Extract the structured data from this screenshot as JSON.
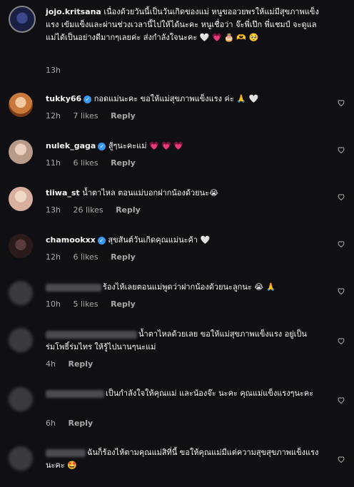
{
  "comments": [
    {
      "user": "jojo.kritsana",
      "verified": false,
      "text": "เนื่องด้วยวันนี้เป็นวันเกิดของแม่ หนูขออวยพรให้แม่มีสุขภาพแข็งแรง เข้มแข็งและผ่านช่วงเวลานี้ไปให้ได้นะคะ หนูเชื่อว่า จ๊ะพี่เป๊ก พี่แชมป์ จะดูแลแม่ได้เป็นอย่างดีมากๆเลยค่ะ ส่งกำลังใจนะคะ 🤍 💗 🎂 🫶 🥺",
      "time": "13h",
      "likes": "",
      "reply": ""
    },
    {
      "user": "tukky66",
      "verified": true,
      "text": "กอดแม่นะคะ ขอให้แม่สุขภาพแข็งแรง ค่ะ 🙏 🤍",
      "time": "12h",
      "likes": "7 likes",
      "reply": "Reply"
    },
    {
      "user": "nulek_gaga",
      "verified": true,
      "text": "สู้ๆนะคะแม่ 💗 💗 💗",
      "time": "11h",
      "likes": "6 likes",
      "reply": "Reply"
    },
    {
      "user": "tiiwa_st",
      "verified": false,
      "text": "น้ำตาไหล ตอนแม่บอกฝากน้องด้วยนะ😭",
      "time": "13h",
      "likes": "26 likes",
      "reply": "Reply"
    },
    {
      "user": "chamookxx",
      "verified": true,
      "text": "สุขสันต์วันเกิดคุณแม่นะค้า 🤍",
      "time": "12h",
      "likes": "6 likes",
      "reply": "Reply"
    },
    {
      "user": "",
      "verified": false,
      "text": "ร้องไห้เลยตอนแม่พูดว่าฝากน้องด้วยนะลูกนะ 😭 🙏",
      "time": "10h",
      "likes": "5 likes",
      "reply": "Reply"
    },
    {
      "user": "",
      "verified": false,
      "text": "น้ำตาไหลด้วยเลย ขอให้แม่สุขภาพแข็งแรง อยู่เป็นร่มโพธิ์ร่มไทร ให้รู้ไปนานๆนะแม่",
      "time": "4h",
      "likes": "",
      "reply": "Reply"
    },
    {
      "user": "",
      "verified": false,
      "text": "เป็นกำลังใจให้คุณแม่ และน้องจ๊ะ นะคะ คุณแม่แข็งแรงๆนะคะ",
      "time": "6h",
      "likes": "",
      "reply": "Reply"
    },
    {
      "user": "",
      "verified": false,
      "text": "ฉันก็ร้องไห้ตามคุณแม่สิที่นี้ ขอให้คุณแม่มีแต่ความสุขสุขภาพแข็งแรงนะคะ 🤩",
      "time": "",
      "likes": "",
      "reply": ""
    }
  ],
  "colors": {
    "background": "#101014",
    "verified": "#3897f0",
    "muted": "#a8a8a8"
  }
}
